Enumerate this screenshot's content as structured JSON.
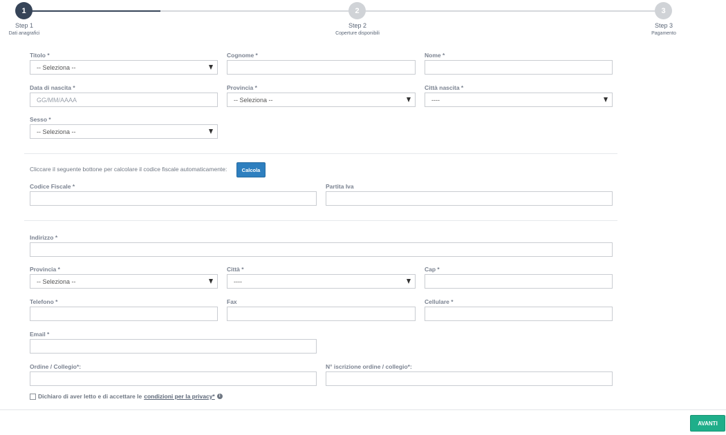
{
  "stepper": {
    "steps": [
      {
        "number": "1",
        "title": "Step 1",
        "subtitle": "Dati anagrafici",
        "state": "active"
      },
      {
        "number": "2",
        "title": "Step 2",
        "subtitle": "Coperture disponibili",
        "state": "inactive"
      },
      {
        "number": "3",
        "title": "Step 3",
        "subtitle": "Pagamento",
        "state": "inactive"
      }
    ],
    "progress_percent": 20
  },
  "personal": {
    "titolo": {
      "label": "Titolo *",
      "value": "-- Seleziona --"
    },
    "cognome": {
      "label": "Cognome *",
      "value": ""
    },
    "nome": {
      "label": "Nome *",
      "value": ""
    },
    "data_nascita": {
      "label": "Data di nascita *",
      "placeholder": "GG/MM/AAAA"
    },
    "provincia": {
      "label": "Provincia *",
      "value": "-- Seleziona --"
    },
    "citta_nascita": {
      "label": "Città nascita *",
      "value": "----"
    },
    "sesso": {
      "label": "Sesso *",
      "value": "-- Seleziona --"
    }
  },
  "fiscal": {
    "hint": "Cliccare il seguente bottone per calcolare il codice fiscale automaticamente:",
    "calcola_label": "Calcola",
    "codice_fiscale": {
      "label": "Codice Fiscale *",
      "value": ""
    },
    "partita_iva": {
      "label": "Partita Iva",
      "value": ""
    }
  },
  "address": {
    "indirizzo": {
      "label": "Indirizzo *",
      "value": ""
    },
    "provincia": {
      "label": "Provincia *",
      "value": "-- Seleziona --"
    },
    "citta": {
      "label": "Città *",
      "value": "----"
    },
    "cap": {
      "label": "Cap *",
      "value": ""
    },
    "telefono": {
      "label": "Telefono *",
      "value": ""
    },
    "fax": {
      "label": "Fax",
      "value": ""
    },
    "cellulare": {
      "label": "Cellulare *",
      "value": ""
    },
    "email": {
      "label": "Email *",
      "value": ""
    },
    "ordine": {
      "label": "Ordine / Collegio*:",
      "value": ""
    },
    "iscrizione": {
      "label": "N° iscrizione ordine / collegio*:",
      "value": ""
    }
  },
  "privacy": {
    "text": "Dichiaro di aver letto e di accettare le",
    "link": "condizioni per la privacy*",
    "checked": false
  },
  "footer": {
    "next_label": "AVANTI"
  },
  "colors": {
    "primary": "#364458",
    "button_blue": "#2e7fbf",
    "button_green": "#1fae8a"
  }
}
